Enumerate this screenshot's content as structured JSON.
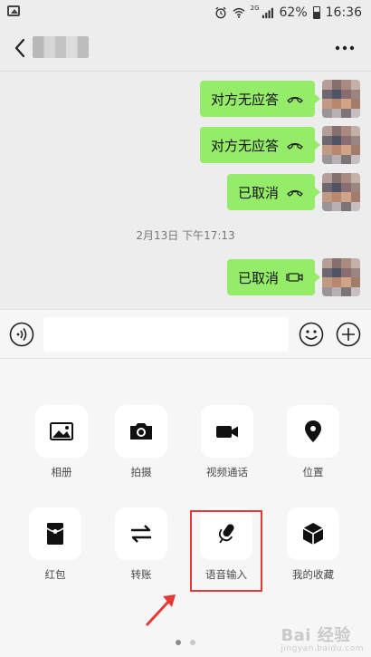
{
  "status_bar": {
    "network_label": "2G",
    "battery_percent": "62%",
    "time": "16:36",
    "icons": [
      "image-icon",
      "alarm-icon",
      "wifi-icon",
      "signal-icon",
      "battery-icon"
    ]
  },
  "header": {
    "back_icon": "back-arrow-icon",
    "more_icon": "more-dots-icon"
  },
  "chat": {
    "messages": [
      {
        "text": "对方无应答",
        "icon": "phone-hangup-icon"
      },
      {
        "text": "对方无应答",
        "icon": "phone-hangup-icon"
      },
      {
        "text": "已取消",
        "icon": "phone-hangup-icon"
      },
      {
        "text": "已取消",
        "icon": "video-call-icon"
      }
    ],
    "timestamp": "2月13日 下午17:13",
    "bubble_color": "#95ec69"
  },
  "input_bar": {
    "value": "",
    "placeholder": ""
  },
  "panel": {
    "tiles": [
      {
        "label": "相册",
        "icon": "photo-icon"
      },
      {
        "label": "拍摄",
        "icon": "camera-icon"
      },
      {
        "label": "视频通话",
        "icon": "video-camera-icon"
      },
      {
        "label": "位置",
        "icon": "location-pin-icon"
      },
      {
        "label": "红包",
        "icon": "red-envelope-icon"
      },
      {
        "label": "转账",
        "icon": "transfer-arrows-icon"
      },
      {
        "label": "语音输入",
        "icon": "microphone-icon"
      },
      {
        "label": "我的收藏",
        "icon": "favorites-cube-icon"
      }
    ],
    "page_count": 2,
    "active_page": 1,
    "highlight_color": "#e53935"
  },
  "watermark": {
    "text": "Bai 经验",
    "sub": "jingyan.baidu.com"
  }
}
